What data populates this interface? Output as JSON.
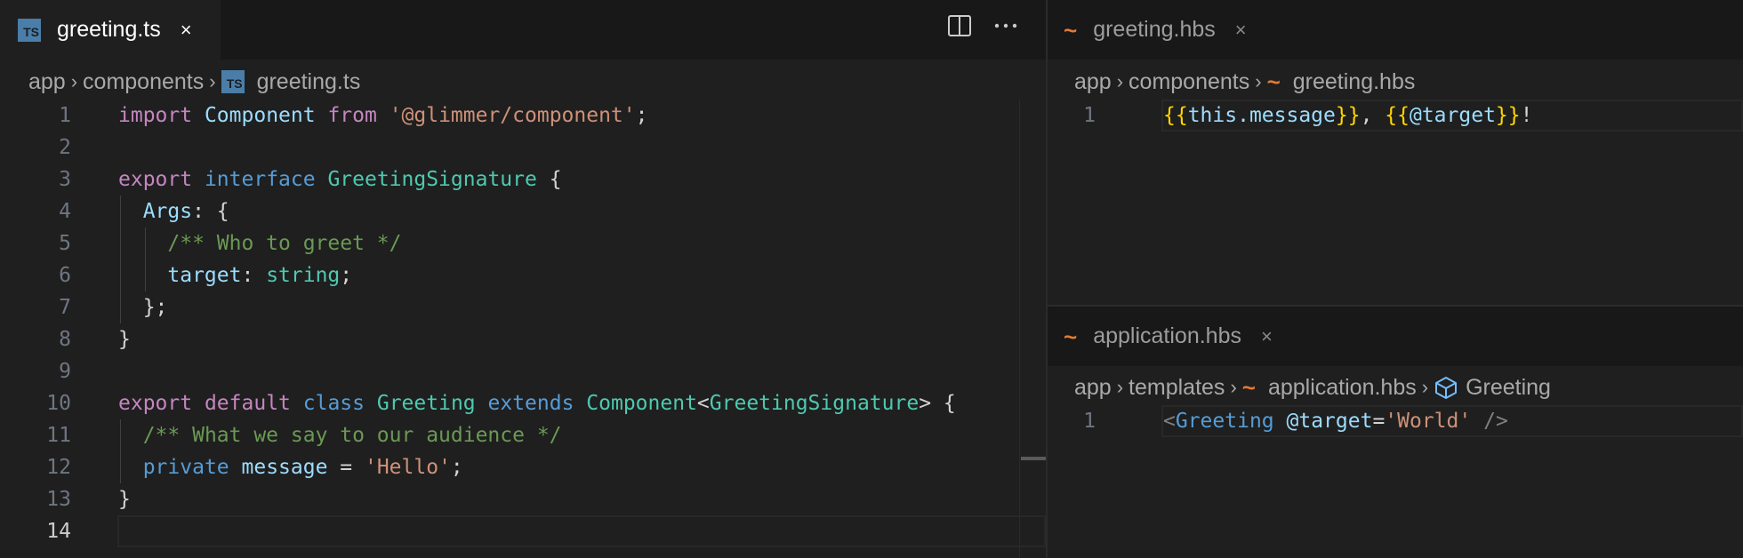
{
  "left_editor": {
    "tab": {
      "label": "greeting.ts",
      "icon": "ts-file-icon",
      "close": "×"
    },
    "actions": [
      "split-editor-icon",
      "more-actions-icon"
    ],
    "breadcrumb": {
      "parts": [
        "app",
        "components",
        "greeting.ts"
      ],
      "separator": "›"
    },
    "current_line": "14",
    "lines": [
      {
        "num": "1",
        "tokens": [
          [
            "kw-purple",
            "import"
          ],
          [
            "plain",
            " "
          ],
          [
            "ident",
            "Component"
          ],
          [
            "plain",
            " "
          ],
          [
            "kw-purple",
            "from"
          ],
          [
            "plain",
            " "
          ],
          [
            "str",
            "'@glimmer/component'"
          ],
          [
            "plain",
            ";"
          ]
        ]
      },
      {
        "num": "2",
        "tokens": []
      },
      {
        "num": "3",
        "tokens": [
          [
            "kw-purple",
            "export"
          ],
          [
            "plain",
            " "
          ],
          [
            "kw-blue",
            "interface"
          ],
          [
            "plain",
            " "
          ],
          [
            "type",
            "GreetingSignature"
          ],
          [
            "plain",
            " {"
          ]
        ]
      },
      {
        "num": "4",
        "tokens": [
          [
            "plain",
            "  "
          ],
          [
            "ident",
            "Args"
          ],
          [
            "plain",
            ": {"
          ]
        ]
      },
      {
        "num": "5",
        "tokens": [
          [
            "plain",
            "    "
          ],
          [
            "comment",
            "/** Who to greet */"
          ]
        ]
      },
      {
        "num": "6",
        "tokens": [
          [
            "plain",
            "    "
          ],
          [
            "ident",
            "target"
          ],
          [
            "plain",
            ": "
          ],
          [
            "type",
            "string"
          ],
          [
            "plain",
            ";"
          ]
        ]
      },
      {
        "num": "7",
        "tokens": [
          [
            "plain",
            "  };"
          ]
        ]
      },
      {
        "num": "8",
        "tokens": [
          [
            "plain",
            "}"
          ]
        ]
      },
      {
        "num": "9",
        "tokens": []
      },
      {
        "num": "10",
        "tokens": [
          [
            "kw-purple",
            "export"
          ],
          [
            "plain",
            " "
          ],
          [
            "kw-purple",
            "default"
          ],
          [
            "plain",
            " "
          ],
          [
            "kw-blue",
            "class"
          ],
          [
            "plain",
            " "
          ],
          [
            "type",
            "Greeting"
          ],
          [
            "plain",
            " "
          ],
          [
            "kw-blue",
            "extends"
          ],
          [
            "plain",
            " "
          ],
          [
            "type",
            "Component"
          ],
          [
            "plain",
            "<"
          ],
          [
            "type",
            "GreetingSignature"
          ],
          [
            "plain",
            "> {"
          ]
        ]
      },
      {
        "num": "11",
        "tokens": [
          [
            "plain",
            "  "
          ],
          [
            "comment",
            "/** What we say to our audience */"
          ]
        ]
      },
      {
        "num": "12",
        "tokens": [
          [
            "plain",
            "  "
          ],
          [
            "kw-blue",
            "private"
          ],
          [
            "plain",
            " "
          ],
          [
            "ident",
            "message"
          ],
          [
            "plain",
            " = "
          ],
          [
            "str",
            "'Hello'"
          ],
          [
            "plain",
            ";"
          ]
        ]
      },
      {
        "num": "13",
        "tokens": [
          [
            "plain",
            "}"
          ]
        ]
      },
      {
        "num": "14",
        "tokens": []
      }
    ]
  },
  "right_top_editor": {
    "tab": {
      "label": "greeting.hbs",
      "icon": "handlebars-file-icon",
      "close": "×"
    },
    "breadcrumb": {
      "parts": [
        "app",
        "components",
        "greeting.hbs"
      ],
      "separator": "›"
    },
    "lines": [
      {
        "num": "1",
        "tokens": [
          [
            "brace",
            "{{"
          ],
          [
            "ident",
            "this.message"
          ],
          [
            "brace",
            "}}"
          ],
          [
            "plain",
            ", "
          ],
          [
            "brace",
            "{{"
          ],
          [
            "ident",
            "@target"
          ],
          [
            "brace",
            "}}"
          ],
          [
            "plain",
            "!"
          ]
        ]
      }
    ]
  },
  "right_bottom_editor": {
    "tab": {
      "label": "application.hbs",
      "icon": "handlebars-file-icon",
      "close": "×"
    },
    "breadcrumb": {
      "parts": [
        "app",
        "templates",
        "application.hbs",
        "Greeting"
      ],
      "separator": "›"
    },
    "lines": [
      {
        "num": "1",
        "tokens": [
          [
            "tag-bracket",
            "<"
          ],
          [
            "kw-blue",
            "Greeting"
          ],
          [
            "plain",
            " "
          ],
          [
            "ident",
            "@target"
          ],
          [
            "plain",
            "="
          ],
          [
            "str",
            "'World'"
          ],
          [
            "plain",
            " "
          ],
          [
            "tag-bracket",
            "/>"
          ]
        ]
      }
    ]
  },
  "colors": {
    "editor_bg": "#1f1f1f",
    "tabbar_bg": "#181818",
    "ts_icon": "#4a7ea8",
    "hbs_icon": "#e37933"
  }
}
